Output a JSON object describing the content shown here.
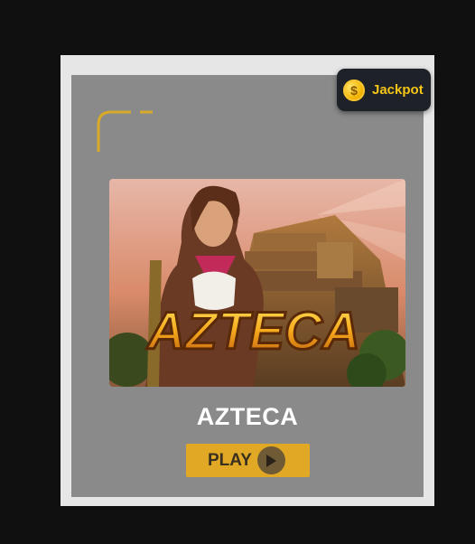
{
  "jackpot": {
    "label": "Jackpot",
    "coin_icon": "dollar-coin-icon",
    "coin_symbol": "$"
  },
  "game": {
    "title": "AZTECA",
    "logo_text": "AZTECA"
  },
  "play": {
    "label": "PLAY",
    "icon": "play-triangle-icon"
  },
  "colors": {
    "accent": "#e0a824",
    "jackpot_text": "#f5c518",
    "card_bg": "#8a8a8a",
    "page_bg": "#101010"
  }
}
